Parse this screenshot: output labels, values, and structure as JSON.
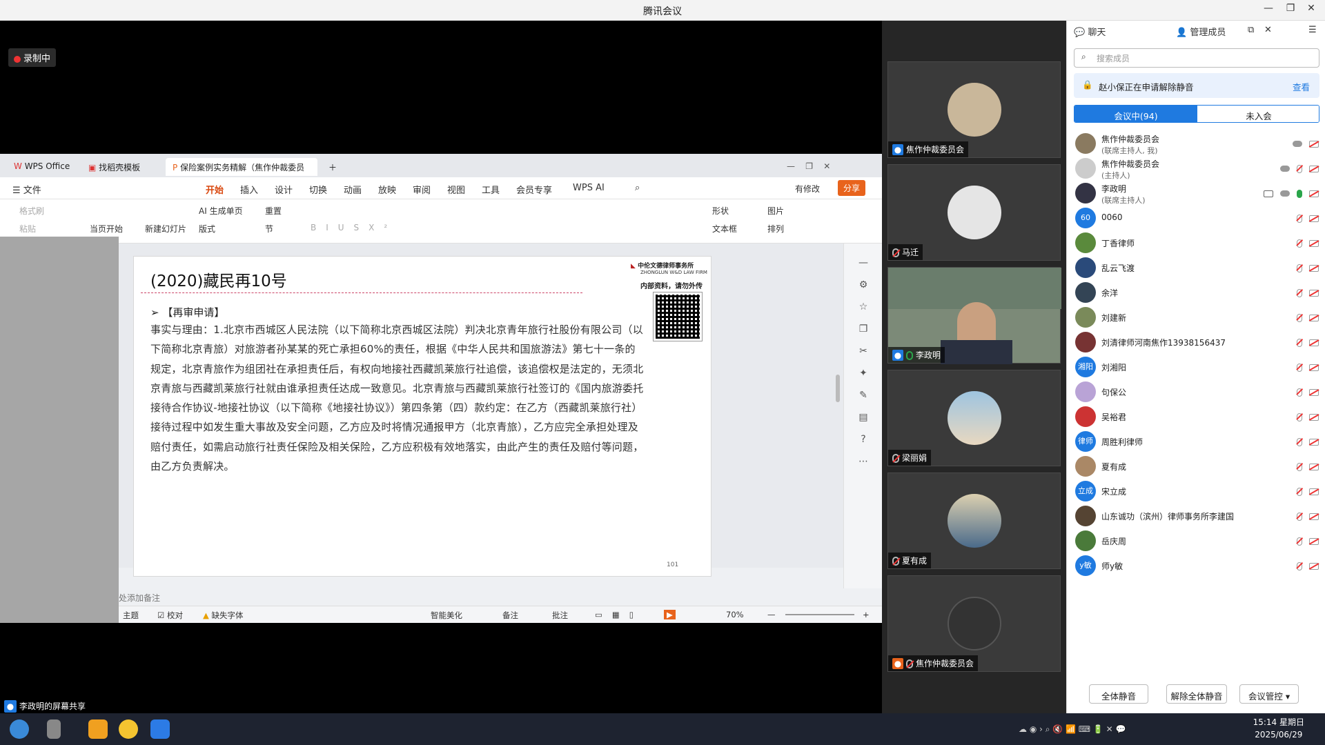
{
  "window": {
    "title": "腾讯会议",
    "min": "—",
    "max": "❐",
    "close": "✕"
  },
  "recording": {
    "label": "录制中"
  },
  "wps": {
    "tabs": [
      "WPS Office",
      "找稻壳模板",
      "保险案例实务精解（焦作仲裁委员"
    ],
    "menu": {
      "file": "文件",
      "items": [
        "开始",
        "插入",
        "设计",
        "切换",
        "动画",
        "放映",
        "审阅",
        "视图",
        "工具",
        "会员专享",
        "WPS AI"
      ],
      "edit_status": "有修改",
      "share": "分享"
    },
    "ribbon": {
      "format_painter": "格式刷",
      "paste": "粘贴",
      "from_start": "当页开始",
      "new_slide": "新建幻灯片",
      "ai_generate": "AI 生成单页",
      "layout": "版式",
      "reset": "重置",
      "section": "节",
      "shape": "形状",
      "picture": "图片",
      "textbox": "文本框",
      "arrange": "排列"
    },
    "slide": {
      "title": "(2020)藏民再10号",
      "subheading": "【再审申请】",
      "body": "事实与理由：1.北京市西城区人民法院（以下简称北京西城区法院）判决北京青年旅行社股份有限公司（以下简称北京青旅）对旅游者孙某某的死亡承担60%的责任，根据《中华人民共和国旅游法》第七十一条的规定，北京青旅作为组团社在承担责任后，有权向地接社西藏凯莱旅行社追偿，该追偿权是法定的，无须北京青旅与西藏凯莱旅行社就由谁承担责任达成一致意见。北京青旅与西藏凯莱旅行社签订的《国内旅游委托接待合作协议-地接社协议（以下简称《地接社协议》）第四条第（四）款约定：在乙方（西藏凯莱旅行社）接待过程中如发生重大事故及安全问题，乙方应及时将情况通报甲方（北京青旅），乙方应完全承担处理及赔付责任，如需启动旅行社责任保险及相关保险，乙方应积极有效地落实，由此产生的责任及赔付等问题，由乙方负责解决。",
      "firm_name_cn": "中伦文德律师事务所",
      "firm_name_en": "ZHONGLUN W&D LAW FIRM",
      "internal_note": "内部资料，请勿外传",
      "page_number": "101"
    },
    "notes_placeholder": "处添加备注",
    "status": {
      "theme": "主题",
      "proofread": "校对",
      "missing_font": "缺失字体",
      "beautify": "智能美化",
      "notes": "备注",
      "comment": "批注",
      "zoom": "70%"
    }
  },
  "share_label": "李政明的屏幕共享",
  "videos": [
    {
      "name": "焦作仲裁委员会",
      "kind": "avatar-dog"
    },
    {
      "name": "马迁",
      "kind": "avatar-sketch"
    },
    {
      "name": "李政明",
      "kind": "camera"
    },
    {
      "name": "梁丽娟",
      "kind": "avatar-beach"
    },
    {
      "name": "夏有成",
      "kind": "avatar-hat"
    },
    {
      "name": "焦作仲裁委员会",
      "kind": "avatar-emblem"
    }
  ],
  "panel": {
    "tab_chat": "聊天",
    "tab_members": "管理成员",
    "search_placeholder": "搜索成员",
    "notice": "赵小保正在申请解除静音",
    "notice_action": "查看",
    "seg_in": "会议中(94)",
    "seg_out": "未入会",
    "members": [
      {
        "name": "焦作仲裁委员会",
        "role": "(联席主持人, 我)",
        "avatar": "",
        "color": "#8a7a60"
      },
      {
        "name": "焦作仲裁委员会",
        "role": "(主持人)",
        "avatar": "",
        "color": "#ccc"
      },
      {
        "name": "李政明",
        "role": "(联席主持人)",
        "avatar": "",
        "color": "#334"
      },
      {
        "name": "0060",
        "role": "",
        "avatar": "60",
        "color": "#1f7ae0"
      },
      {
        "name": "丁香律师",
        "role": "",
        "avatar": "",
        "color": "#5a8a3c"
      },
      {
        "name": "乱云飞渡",
        "role": "",
        "avatar": "",
        "color": "#2a4a7a"
      },
      {
        "name": "余洋",
        "role": "",
        "avatar": "",
        "color": "#345"
      },
      {
        "name": "刘建新",
        "role": "",
        "avatar": "",
        "color": "#7a8a5a"
      },
      {
        "name": "刘清律师河南焦作13938156437",
        "role": "",
        "avatar": "",
        "color": "#733"
      },
      {
        "name": "刘湘阳",
        "role": "",
        "avatar": "湘阳",
        "color": "#1f7ae0"
      },
      {
        "name": "句保公",
        "role": "",
        "avatar": "",
        "color": "#b9a3d6"
      },
      {
        "name": "吴裕君",
        "role": "",
        "avatar": "",
        "color": "#c33"
      },
      {
        "name": "周胜利律师",
        "role": "",
        "avatar": "律师",
        "color": "#1f7ae0"
      },
      {
        "name": "夏有成",
        "role": "",
        "avatar": "",
        "color": "#a86"
      },
      {
        "name": "宋立成",
        "role": "",
        "avatar": "立成",
        "color": "#1f7ae0"
      },
      {
        "name": "山东诚功（滨州）律师事务所李建国",
        "role": "",
        "avatar": "",
        "color": "#543"
      },
      {
        "name": "岳庆周",
        "role": "",
        "avatar": "",
        "color": "#4a7a3a"
      },
      {
        "name": "师y敏",
        "role": "",
        "avatar": "y敏",
        "color": "#1f7ae0"
      }
    ],
    "btn_mute_all": "全体静音",
    "btn_unmute_all": "解除全体静音",
    "btn_control": "会议管控"
  },
  "taskbar": {
    "time": "15:14 星期日",
    "date": "2025/06/29"
  }
}
